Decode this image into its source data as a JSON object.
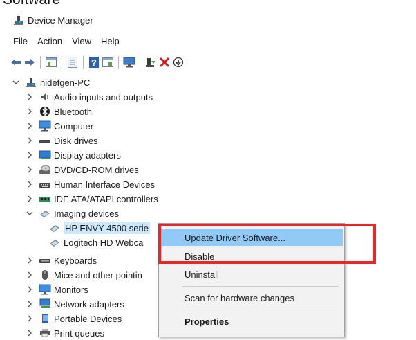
{
  "clipped_heading": "Software",
  "window": {
    "title": "Device Manager"
  },
  "menu": [
    "File",
    "Action",
    "View",
    "Help"
  ],
  "tree": {
    "root": "hidefgen-PC",
    "items": [
      {
        "label": "Audio inputs and outputs",
        "icon": "speaker-icon"
      },
      {
        "label": "Bluetooth",
        "icon": "bluetooth-icon"
      },
      {
        "label": "Computer",
        "icon": "monitor-icon"
      },
      {
        "label": "Disk drives",
        "icon": "disk-drive-icon"
      },
      {
        "label": "Display adapters",
        "icon": "display-adapter-icon"
      },
      {
        "label": "DVD/CD-ROM drives",
        "icon": "dvd-drive-icon"
      },
      {
        "label": "Human Interface Devices",
        "icon": "hid-icon"
      },
      {
        "label": "IDE ATA/ATAPI controllers",
        "icon": "ide-controller-icon"
      },
      {
        "label": "Imaging devices",
        "icon": "imaging-device-icon"
      }
    ],
    "imaging_children": [
      {
        "label": "HP ENVY 4500 serie",
        "selected": true
      },
      {
        "label": "Logitech HD Webca",
        "selected": false
      }
    ],
    "items_after": [
      {
        "label": "Keyboards",
        "icon": "keyboard-icon"
      },
      {
        "label": "Mice and other pointin",
        "icon": "mouse-icon"
      },
      {
        "label": "Monitors",
        "icon": "monitor-icon"
      },
      {
        "label": "Network adapters",
        "icon": "network-adapter-icon"
      },
      {
        "label": "Portable Devices",
        "icon": "portable-device-icon"
      },
      {
        "label": "Print queues",
        "icon": "printer-icon"
      }
    ]
  },
  "context_menu": {
    "items": [
      {
        "label": "Update Driver Software...",
        "highlighted": true,
        "bold": false
      },
      {
        "label": "Disable",
        "highlighted": false,
        "bold": false
      },
      {
        "label": "Uninstall",
        "highlighted": false,
        "bold": false
      },
      {
        "label": "Scan for hardware changes",
        "highlighted": false,
        "bold": false
      },
      {
        "label": "Properties",
        "highlighted": false,
        "bold": true
      }
    ]
  },
  "colors": {
    "selection": "#cce8ff",
    "menu_highlight": "#91c9f7",
    "annotation_border": "#e8262a"
  }
}
